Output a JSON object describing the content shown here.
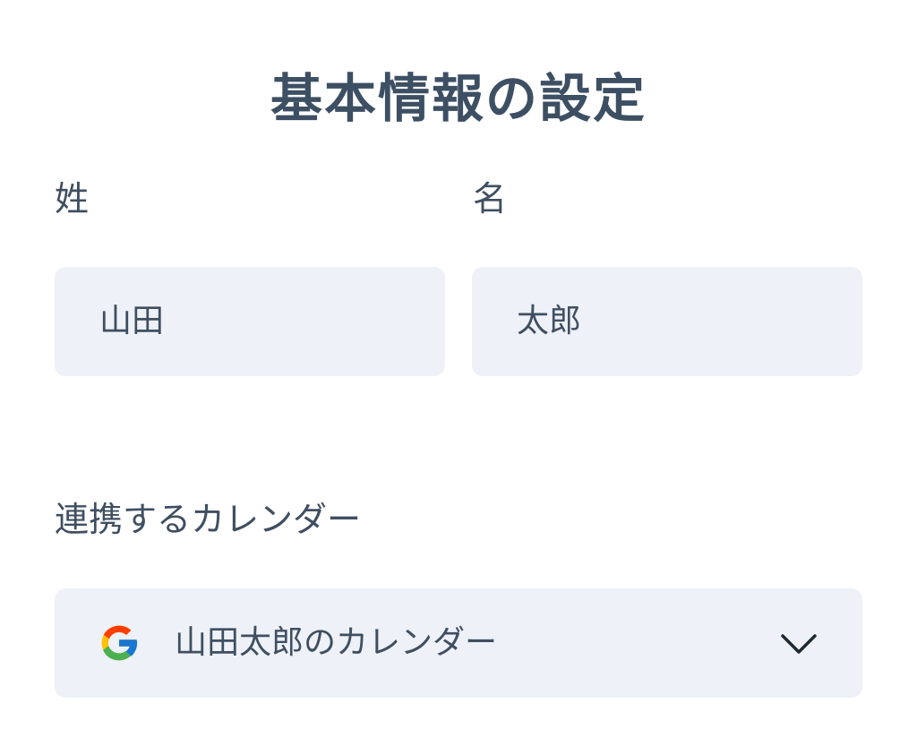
{
  "page": {
    "title": "基本情報の設定"
  },
  "form": {
    "last_name": {
      "label": "姓",
      "value": "山田"
    },
    "first_name": {
      "label": "名",
      "value": "太郎"
    },
    "calendar": {
      "label": "連携するカレンダー",
      "selected": "山田太郎のカレンダー",
      "provider_icon": "google-icon",
      "dropdown_icon": "chevron-down-icon"
    }
  },
  "colors": {
    "text": "#3f4f61",
    "field_background": "#eef1f8",
    "google_blue": "#4285F4",
    "google_red": "#EA4335",
    "google_yellow": "#FBBC05",
    "google_green": "#34A853"
  }
}
